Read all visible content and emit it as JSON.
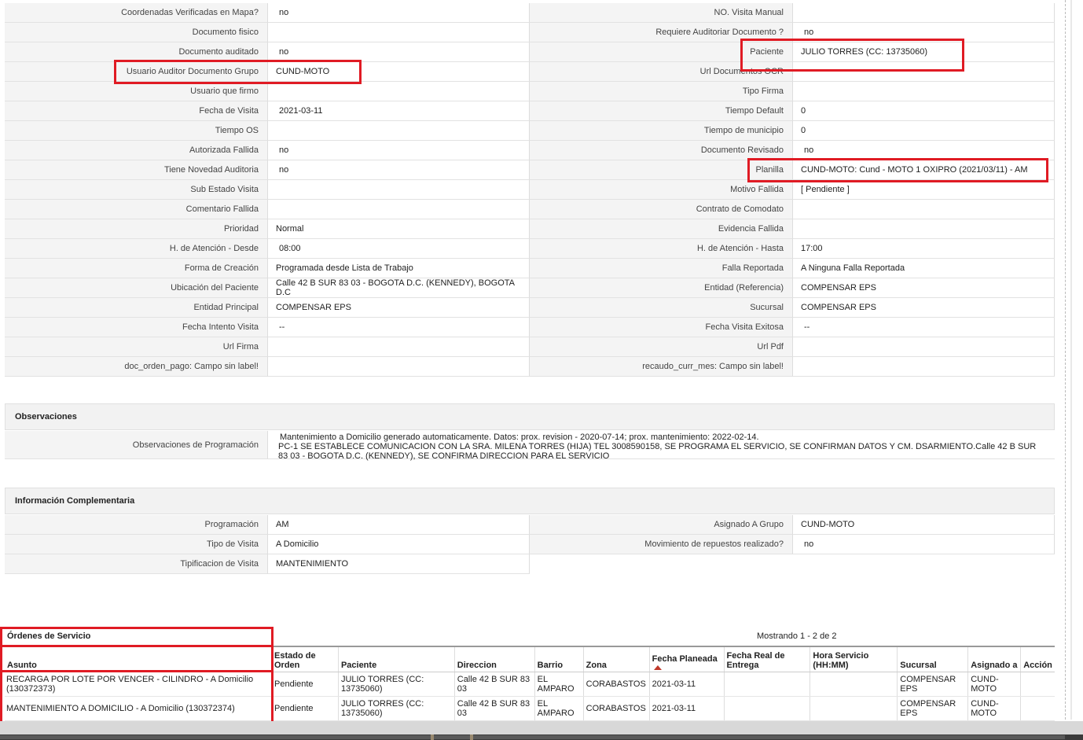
{
  "detail_rows": [
    {
      "l1": "Coordenadas Verificadas en Mapa?",
      "v1": "no",
      "l2": "NO. Visita Manual",
      "v2": ""
    },
    {
      "l1": "Documento fisico",
      "v1": "",
      "l2": "Requiere Auditoriar Documento ?",
      "v2": "no"
    },
    {
      "l1": "Documento auditado",
      "v1": "no",
      "l2": "Paciente",
      "v2": "JULIO TORRES (CC: 13735060)"
    },
    {
      "l1": "Usuario Auditor Documento Grupo",
      "v1": "CUND-MOTO",
      "l2": "Url Documentos OCR",
      "v2": ""
    },
    {
      "l1": "Usuario que firmo",
      "v1": "",
      "l2": "Tipo Firma",
      "v2": ""
    },
    {
      "l1": "Fecha de Visita",
      "v1": "2021-03-11",
      "l2": "Tiempo Default",
      "v2": "0"
    },
    {
      "l1": "Tiempo OS",
      "v1": "",
      "l2": "Tiempo de municipio",
      "v2": "0"
    },
    {
      "l1": "Autorizada Fallida",
      "v1": "no",
      "l2": "Documento Revisado",
      "v2": "no"
    },
    {
      "l1": "Tiene Novedad Auditoria",
      "v1": "no",
      "l2": "Planilla",
      "v2": "CUND-MOTO: Cund - MOTO 1 OXIPRO (2021/03/11) - AM"
    },
    {
      "l1": "Sub Estado Visita",
      "v1": "",
      "l2": "Motivo Fallida",
      "v2": "[ Pendiente ]"
    },
    {
      "l1": "Comentario Fallida",
      "v1": "",
      "l2": "Contrato de Comodato",
      "v2": ""
    },
    {
      "l1": "Prioridad",
      "v1": "Normal",
      "l2": "Evidencia Fallida",
      "v2": ""
    },
    {
      "l1": "H. de Atención - Desde",
      "v1": "08:00",
      "l2": "H. de Atención - Hasta",
      "v2": "17:00"
    },
    {
      "l1": "Forma de Creación",
      "v1": "Programada desde Lista de Trabajo",
      "l2": "Falla Reportada",
      "v2": "A Ninguna Falla Reportada"
    },
    {
      "l1": "Ubicación del Paciente",
      "v1": "Calle 42 B SUR 83 03 - BOGOTA D.C. (KENNEDY), BOGOTA D.C",
      "l2": "Entidad (Referencia)",
      "v2": "COMPENSAR EPS"
    },
    {
      "l1": "Entidad Principal",
      "v1": "COMPENSAR EPS",
      "l2": "Sucursal",
      "v2": "COMPENSAR EPS"
    },
    {
      "l1": "Fecha Intento Visita",
      "v1": "--",
      "l2": "Fecha Visita Exitosa",
      "v2": "--"
    },
    {
      "l1": "Url Firma",
      "v1": "",
      "l2": "Url Pdf",
      "v2": ""
    },
    {
      "l1": "doc_orden_pago: Campo sin label!",
      "v1": "",
      "l2": "recaudo_curr_mes: Campo sin label!",
      "v2": ""
    }
  ],
  "observaciones": {
    "title": "Observaciones",
    "label": "Observaciones de Programación",
    "line1": "Mantenimiento a Domicilio generado automaticamente. Datos: prox. revision - 2020-07-14; prox. mantenimiento: 2022-02-14.",
    "line2": "PC-1 SE ESTABLECE COMUNICACION CON LA SRA. MILENA TORRES (HIJA) TEL 3008590158, SE PROGRAMA EL SERVICIO, SE CONFIRMAN DATOS Y CM. DSARMIENTO.Calle 42 B SUR 83 03 - BOGOTA D.C. (KENNEDY), SE CONFIRMA DIRECCION PARA EL SERVICIO"
  },
  "complementaria": {
    "title": "Información Complementaria",
    "rows": [
      {
        "l1": "Programación",
        "v1": "AM",
        "l2": "Asignado A Grupo",
        "v2": "CUND-MOTO"
      },
      {
        "l1": "Tipo de Visita",
        "v1": "A Domicilio",
        "l2": "Movimiento de repuestos realizado?",
        "v2": "no"
      },
      {
        "l1": "Tipificacion de Visita",
        "v1": "MANTENIMIENTO"
      }
    ]
  },
  "ordenes": {
    "title": "Órdenes de Servicio",
    "showing": "Mostrando 1 - 2 de 2",
    "columns": [
      "Asunto",
      "Estado de Orden",
      "Paciente",
      "Direccion",
      "Barrio",
      "Zona",
      "Fecha Planeada",
      "Fecha Real de Entrega",
      "Hora Servicio (HH:MM)",
      "Sucursal",
      "Asignado a",
      "Acción"
    ],
    "rows": [
      {
        "asunto": "RECARGA POR LOTE POR VENCER - CILINDRO - A Domicilio (130372373)",
        "estado": "Pendiente",
        "paciente": "JULIO TORRES (CC: 13735060)",
        "direccion": "Calle 42 B SUR 83 03",
        "barrio": "EL AMPARO",
        "zona": "CORABASTOS",
        "fecha_planeada": "2021-03-11",
        "fecha_real": "",
        "hora": "",
        "sucursal": "COMPENSAR EPS",
        "asignado": "CUND-MOTO",
        "accion": ""
      },
      {
        "asunto": "MANTENIMIENTO A DOMICILIO - A Domicilio (130372374)",
        "estado": "Pendiente",
        "paciente": "JULIO TORRES (CC: 13735060)",
        "direccion": "Calle 42 B SUR 83 03",
        "barrio": "EL AMPARO",
        "zona": "CORABASTOS",
        "fecha_planeada": "2021-03-11",
        "fecha_real": "",
        "hora": "",
        "sucursal": "COMPENSAR EPS",
        "asignado": "CUND-MOTO",
        "accion": ""
      }
    ]
  },
  "colors": {
    "highlight": "#e01b24",
    "sort_arrow": "#c0392b"
  }
}
